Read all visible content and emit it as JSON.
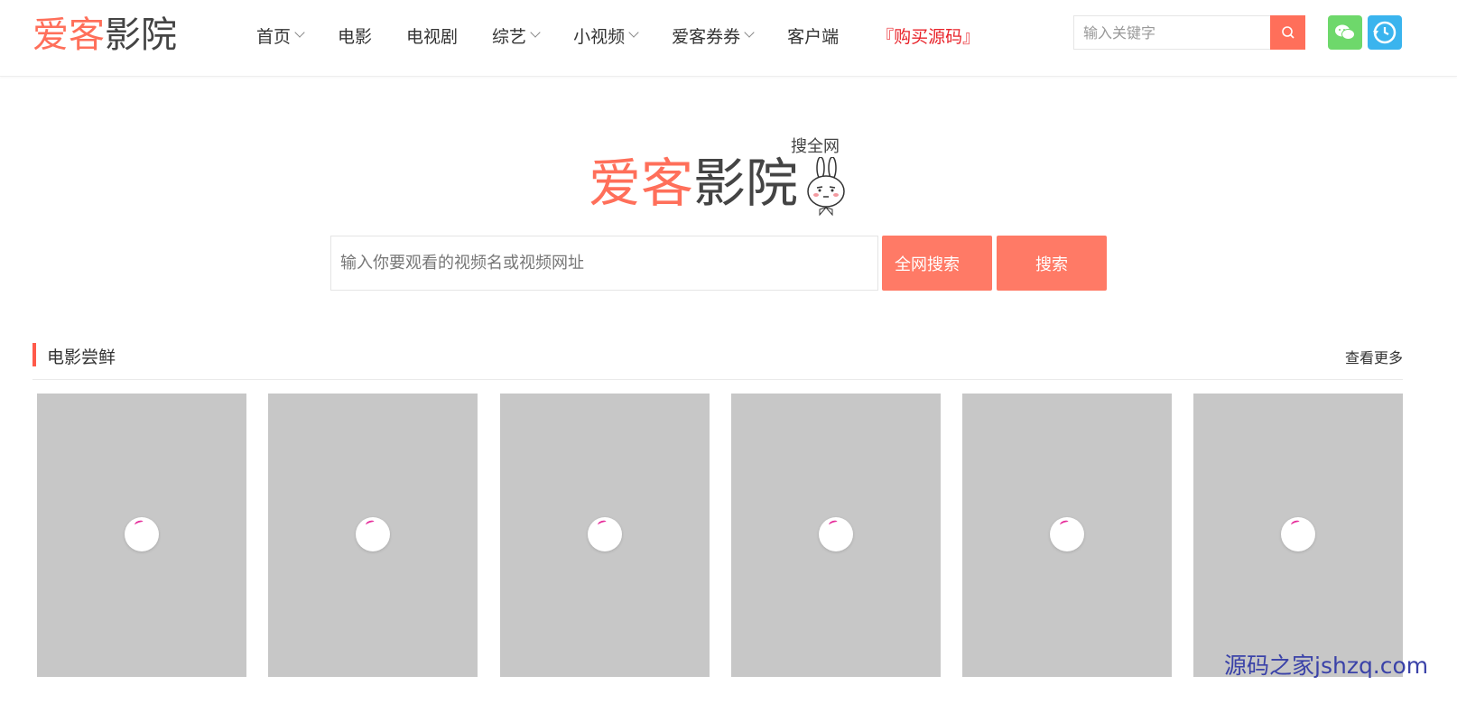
{
  "header": {
    "logo": {
      "part1": "爱客",
      "part2": "影院"
    },
    "nav": [
      {
        "label": "首页",
        "dropdown": true
      },
      {
        "label": "电影",
        "dropdown": false
      },
      {
        "label": "电视剧",
        "dropdown": false
      },
      {
        "label": "综艺",
        "dropdown": true
      },
      {
        "label": "小视频",
        "dropdown": true
      },
      {
        "label": "爱客券券",
        "dropdown": true
      },
      {
        "label": "客户端",
        "dropdown": false
      },
      {
        "label": "『购买源码』",
        "dropdown": false,
        "highlight": true
      }
    ],
    "search": {
      "placeholder": "输入关键字",
      "icon": "search-icon"
    },
    "icons": [
      "wechat-icon",
      "history-icon"
    ]
  },
  "hero": {
    "logo": {
      "badge": "搜全网",
      "part1": "爱客",
      "part2": "影院",
      "mascot": "rabbit-mascot-icon"
    },
    "search": {
      "placeholder": "输入你要观看的视频名或视频网址",
      "btn_all": "全网搜索",
      "btn_search": "搜索"
    }
  },
  "section": {
    "title": "电影尝鲜",
    "more": "查看更多",
    "card_count": 6
  },
  "watermark": "源码之家jshzq.com",
  "colors": {
    "accent": "#ff6f5a",
    "highlight": "#e8232a",
    "wechat": "#6ed86b",
    "history": "#3ab4ee"
  }
}
